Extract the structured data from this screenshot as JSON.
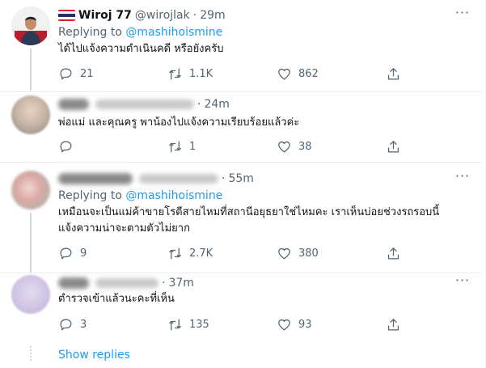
{
  "tweets": [
    {
      "name": "Wiroj 77",
      "handle": "@wirojlak",
      "time": "29m",
      "replying_prefix": "Replying to",
      "replying_to": "@mashihoismine",
      "text": "ได้ไปแจ้งความดำเนินคดี หรือยังครับ",
      "replies": "21",
      "retweets": "1.1K",
      "likes": "862",
      "flag_colors": [
        "#e3172b",
        "#ffffff",
        "#2d2a6e"
      ]
    },
    {
      "time": "24m",
      "text": "พ่อแม่ และคุณครู พาน้องไปแจ้งความเรียบร้อยแล้วค่ะ",
      "replies": "",
      "retweets": "1",
      "likes": "38"
    },
    {
      "time": "55m",
      "replying_prefix": "Replying to",
      "replying_to": "@mashihoismine",
      "text": "เหมือนจะเป็นแม่ค้าขายโรตีสายไหมที่สถานีอยุธยาใช่ไหมคะ เราเห็นบ่อยช่วงรถรอบนี้\nแจ้งความน่าจะตามตัวไม่ยาก",
      "replies": "9",
      "retweets": "2.7K",
      "likes": "380"
    },
    {
      "time": "37m",
      "text": "ตำรวจเข้าแล้วนะคะที่เห็น",
      "replies": "3",
      "retweets": "135",
      "likes": "93"
    }
  ],
  "show_replies": "Show replies",
  "icons": {
    "reply": "reply-icon",
    "retweet": "retweet-icon",
    "like": "heart-icon",
    "share": "share-icon",
    "more": "more-options-icon"
  },
  "colors": {
    "accent": "#1d9bf0",
    "muted": "#536471",
    "divider": "#e6ecf0"
  }
}
